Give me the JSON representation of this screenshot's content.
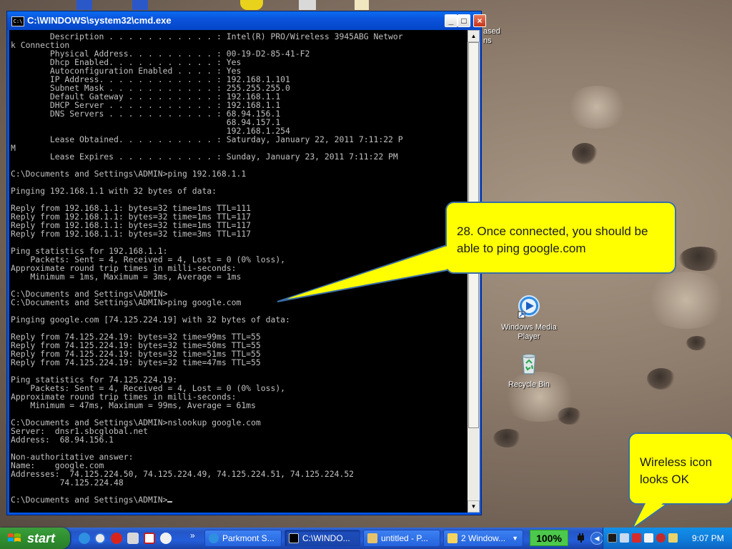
{
  "desktop": {
    "partial_label_lines": [
      "ased",
      "ns"
    ],
    "icons": [
      {
        "label_lines": [
          "Windows Media",
          "Player"
        ],
        "icon": "windows-media-player-icon"
      },
      {
        "label_lines": [
          "Recycle Bin"
        ],
        "icon": "recycle-bin-icon"
      }
    ]
  },
  "cmd_window": {
    "title": "C:\\WINDOWS\\system32\\cmd.exe",
    "lines": [
      "        Description . . . . . . . . . . . : Intel(R) PRO/Wireless 3945ABG Networ",
      "k Connection",
      "        Physical Address. . . . . . . . . : 00-19-D2-85-41-F2",
      "        Dhcp Enabled. . . . . . . . . . . : Yes",
      "        Autoconfiguration Enabled . . . . : Yes",
      "        IP Address. . . . . . . . . . . . : 192.168.1.101",
      "        Subnet Mask . . . . . . . . . . . : 255.255.255.0",
      "        Default Gateway . . . . . . . . . : 192.168.1.1",
      "        DHCP Server . . . . . . . . . . . : 192.168.1.1",
      "        DNS Servers . . . . . . . . . . . : 68.94.156.1",
      "                                            68.94.157.1",
      "                                            192.168.1.254",
      "        Lease Obtained. . . . . . . . . . : Saturday, January 22, 2011 7:11:22 P",
      "M",
      "        Lease Expires . . . . . . . . . . : Sunday, January 23, 2011 7:11:22 PM",
      "",
      "C:\\Documents and Settings\\ADMIN>ping 192.168.1.1",
      "",
      "Pinging 192.168.1.1 with 32 bytes of data:",
      "",
      "Reply from 192.168.1.1: bytes=32 time=1ms TTL=111",
      "Reply from 192.168.1.1: bytes=32 time=1ms TTL=117",
      "Reply from 192.168.1.1: bytes=32 time=1ms TTL=117",
      "Reply from 192.168.1.1: bytes=32 time=3ms TTL=117",
      "",
      "Ping statistics for 192.168.1.1:",
      "    Packets: Sent = 4, Received = 4, Lost = 0 (0% loss),",
      "Approximate round trip times in milli-seconds:",
      "    Minimum = 1ms, Maximum = 3ms, Average = 1ms",
      "",
      "C:\\Documents and Settings\\ADMIN>",
      "C:\\Documents and Settings\\ADMIN>ping google.com",
      "",
      "Pinging google.com [74.125.224.19] with 32 bytes of data:",
      "",
      "Reply from 74.125.224.19: bytes=32 time=99ms TTL=55",
      "Reply from 74.125.224.19: bytes=32 time=50ms TTL=55",
      "Reply from 74.125.224.19: bytes=32 time=51ms TTL=55",
      "Reply from 74.125.224.19: bytes=32 time=47ms TTL=55",
      "",
      "Ping statistics for 74.125.224.19:",
      "    Packets: Sent = 4, Received = 4, Lost = 0 (0% loss),",
      "Approximate round trip times in milli-seconds:",
      "    Minimum = 47ms, Maximum = 99ms, Average = 61ms",
      "",
      "C:\\Documents and Settings\\ADMIN>nslookup google.com",
      "Server:  dnsr1.sbcglobal.net",
      "Address:  68.94.156.1",
      "",
      "Non-authoritative answer:",
      "Name:    google.com",
      "Addresses:  74.125.224.50, 74.125.224.49, 74.125.224.51, 74.125.224.52",
      "          74.125.224.48",
      "",
      "C:\\Documents and Settings\\ADMIN>"
    ]
  },
  "callouts": {
    "main": "28. Once connected, you should be able to ping google.com",
    "wireless": "Wireless icon looks OK"
  },
  "taskbar": {
    "start_label": "start",
    "more_label": "»",
    "tasks": [
      {
        "label": "Parkmont S...",
        "icon": "internet-explorer-icon",
        "active": false
      },
      {
        "label": "C:\\WINDO...",
        "icon": "cmd-icon",
        "active": true
      },
      {
        "label": "untitled - P...",
        "icon": "paint-icon",
        "active": false
      },
      {
        "label": "2 Window...",
        "icon": "folder-icon",
        "active": false
      }
    ],
    "zoom": "100%",
    "clock": "9:07 PM"
  },
  "colors": {
    "callout_fill": "#ffff00",
    "callout_border": "#3a6ea5",
    "taskbar_blue": "#245edb",
    "start_green": "#3c9e3c"
  }
}
